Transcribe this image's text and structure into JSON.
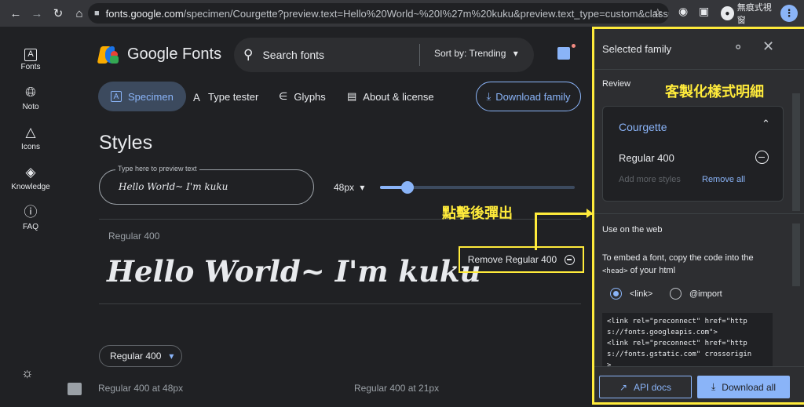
{
  "browser": {
    "url_host": "fonts.google.com",
    "url_rest": "/specimen/Courgette?preview.text=Hello%20World~%20I%27m%20kuku&preview.text_type=custom&classifi...",
    "profile_label": "無痕式視窗"
  },
  "rail": {
    "items": [
      {
        "label": "Fonts",
        "icon": "fonts-icon"
      },
      {
        "label": "Noto",
        "icon": "globe-icon"
      },
      {
        "label": "Icons",
        "icon": "shapes-icon"
      },
      {
        "label": "Knowledge",
        "icon": "graduation-cap-icon"
      },
      {
        "label": "FAQ",
        "icon": "help-icon"
      }
    ]
  },
  "header": {
    "logo_text": "Google Fonts",
    "search_placeholder": "Search fonts",
    "sort_label": "Sort by: Trending"
  },
  "tabs": [
    {
      "label": "Specimen",
      "active": true
    },
    {
      "label": "Type tester"
    },
    {
      "label": "Glyphs"
    },
    {
      "label": "About & license"
    }
  ],
  "download_family_label": "Download family",
  "styles": {
    "heading": "Styles",
    "preview_label": "Type here to preview text",
    "preview_value": "Hello World~ I'm kuku",
    "size_value": "48px",
    "size_slider_fraction": 0.14,
    "style_label": "Regular 400",
    "sample_text": "Hello World~ I'm kuku",
    "remove_button_label": "Remove Regular 400",
    "annotation_popup": "點擊後彈出",
    "weight_select": "Regular 400",
    "foot_left": "Regular 400 at 48px",
    "foot_right": "Regular 400 at 21px"
  },
  "panel": {
    "title": "Selected family",
    "review_label": "Review",
    "annotation_title": "客製化樣式明細",
    "family_name": "Courgette",
    "selected_style": "Regular 400",
    "add_more_styles": "Add more styles",
    "remove_all": "Remove all",
    "web_heading": "Use on the web",
    "embed_text_1": "To embed a font, copy the code into the",
    "embed_text_code": "<head>",
    "embed_text_2": "of your html",
    "radio_link": "<link>",
    "radio_import": "@import",
    "code_lines": [
      "<link rel=\"preconnect\" href=\"http",
      "s://fonts.googleapis.com\">",
      "<link rel=\"preconnect\" href=\"http",
      "s://fonts.gstatic.com\" crossorigin",
      ">"
    ],
    "api_docs": "API docs",
    "download_all": "Download all"
  },
  "colors": {
    "accent": "#8ab4f8",
    "annotation": "#ffeb3b",
    "background": "#202124"
  }
}
